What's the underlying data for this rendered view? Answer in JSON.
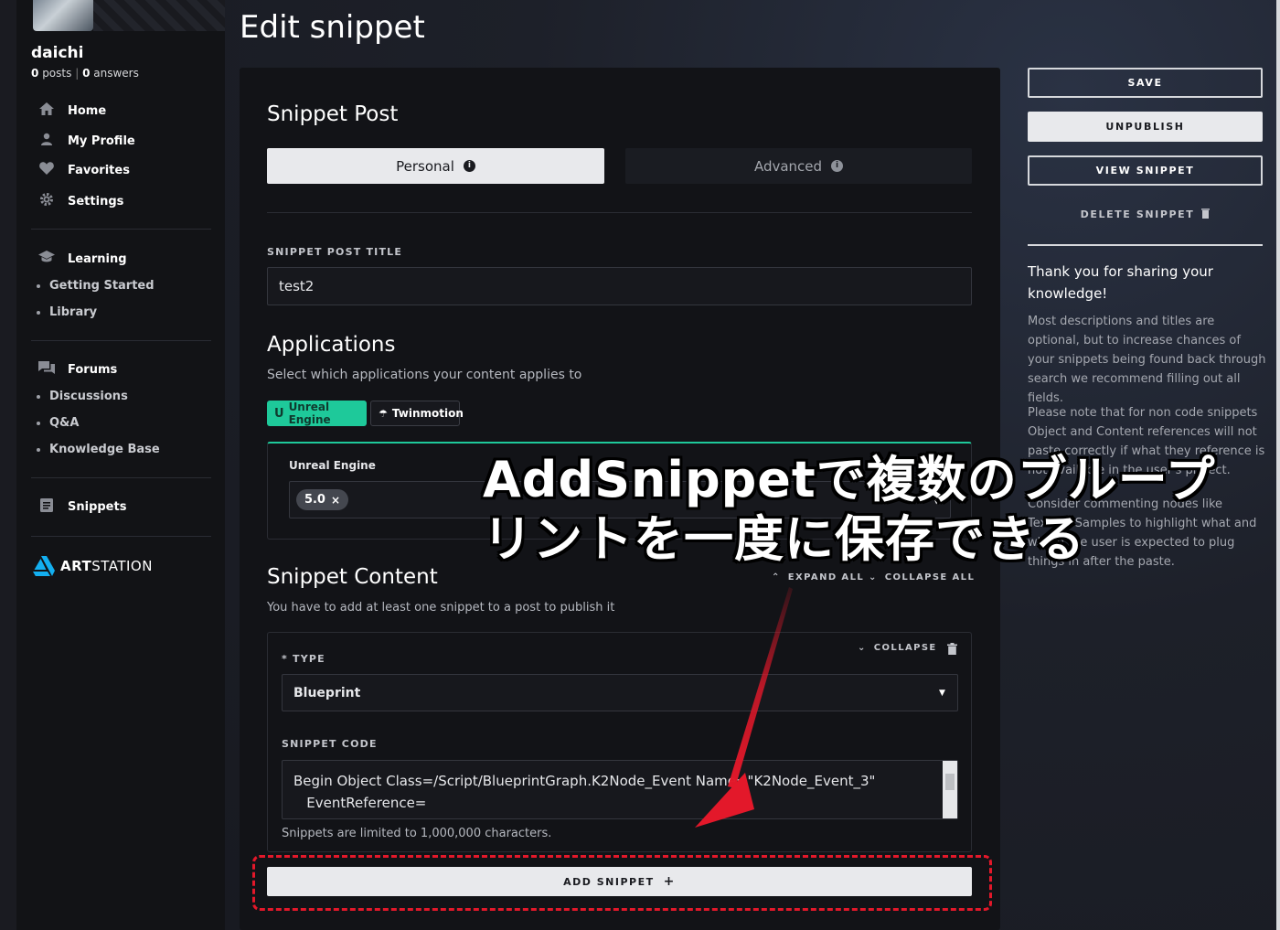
{
  "user": {
    "name": "daichi",
    "posts_count": "0",
    "posts_label": "posts",
    "answers_count": "0",
    "answers_label": "answers"
  },
  "nav": {
    "home": "Home",
    "profile": "My Profile",
    "favorites": "Favorites",
    "settings": "Settings",
    "learning": "Learning",
    "getting_started": "Getting Started",
    "library": "Library",
    "forums": "Forums",
    "discussions": "Discussions",
    "qa": "Q&A",
    "knowledge_base": "Knowledge Base",
    "snippets": "Snippets",
    "brand_bold": "ART",
    "brand_rest": "STATION"
  },
  "page_title": "Edit snippet",
  "snippet_post": {
    "heading": "Snippet Post",
    "tab_personal": "Personal",
    "tab_advanced": "Advanced",
    "title_label": "SNIPPET POST TITLE",
    "title_value": "test2"
  },
  "applications": {
    "heading": "Applications",
    "description": "Select which applications your content applies to",
    "chip_unreal": "Unreal Engine",
    "chip_twinmotion": "Twinmotion",
    "box_label": "Unreal Engine",
    "version": "5.0"
  },
  "content": {
    "heading": "Snippet Content",
    "expand_all": "EXPAND ALL",
    "collapse_all": "COLLAPSE ALL",
    "description": "You have to add at least one snippet to a post to publish it",
    "collapse": "COLLAPSE",
    "type_label": "TYPE",
    "type_required_mark": "*",
    "type_value": "Blueprint",
    "code_label": "SNIPPET CODE",
    "code_line1": "Begin Object Class=/Script/BlueprintGraph.K2Node_Event Name=\"K2Node_Event_3\"",
    "code_line2": "   EventReference=",
    "limit_note": "Snippets are limited to 1,000,000 characters.",
    "add_snippet": "ADD SNIPPET"
  },
  "actions": {
    "save": "SAVE",
    "unpublish": "UNPUBLISH",
    "view_snippet": "VIEW SNIPPET",
    "delete_snippet": "DELETE SNIPPET"
  },
  "tips": {
    "title": "Thank you for sharing your knowledge!",
    "p1": "Most descriptions and titles are optional, but to increase chances of your snippets being found back through search we recommend filling out all fields.",
    "p2": "Please note that for non code snippets Object and Content references will not paste correctly if what they reference is not available in the user's project.",
    "p3": "Consider commenting nodes like Texture Samples to highlight what and where the user is expected to plug things in after the paste."
  },
  "annotation": {
    "line1": "AddSnippetで複数のブループ",
    "line2": "リントを一度に保存できる",
    "color": "#e3182a"
  },
  "colors": {
    "accent": "#1ec99a",
    "highlight_red": "#e3182a"
  }
}
